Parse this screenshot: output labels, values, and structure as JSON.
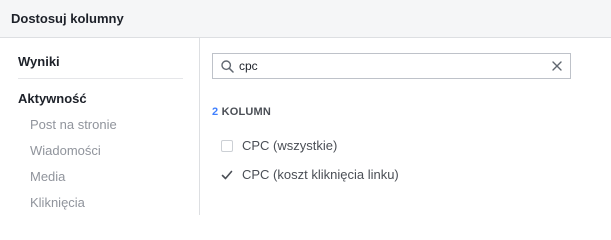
{
  "header": {
    "title": "Dostosuj kolumny"
  },
  "sidebar": {
    "sections": [
      {
        "title": "Wyniki"
      },
      {
        "title": "Aktywność"
      }
    ],
    "items": [
      "Post na stronie",
      "Wiadomości",
      "Media",
      "Kliknięcia"
    ]
  },
  "search": {
    "value": "cpc",
    "placeholder": ""
  },
  "results": {
    "count": "2",
    "count_suffix": "KOLUMN",
    "options": [
      {
        "label": "CPC (wszystkie)",
        "checked": false
      },
      {
        "label": "CPC (koszt kliknięcia linku)",
        "checked": true
      }
    ]
  },
  "colors": {
    "accent": "#4080ff",
    "muted_text": "#90949c",
    "border": "#dddfe2"
  }
}
